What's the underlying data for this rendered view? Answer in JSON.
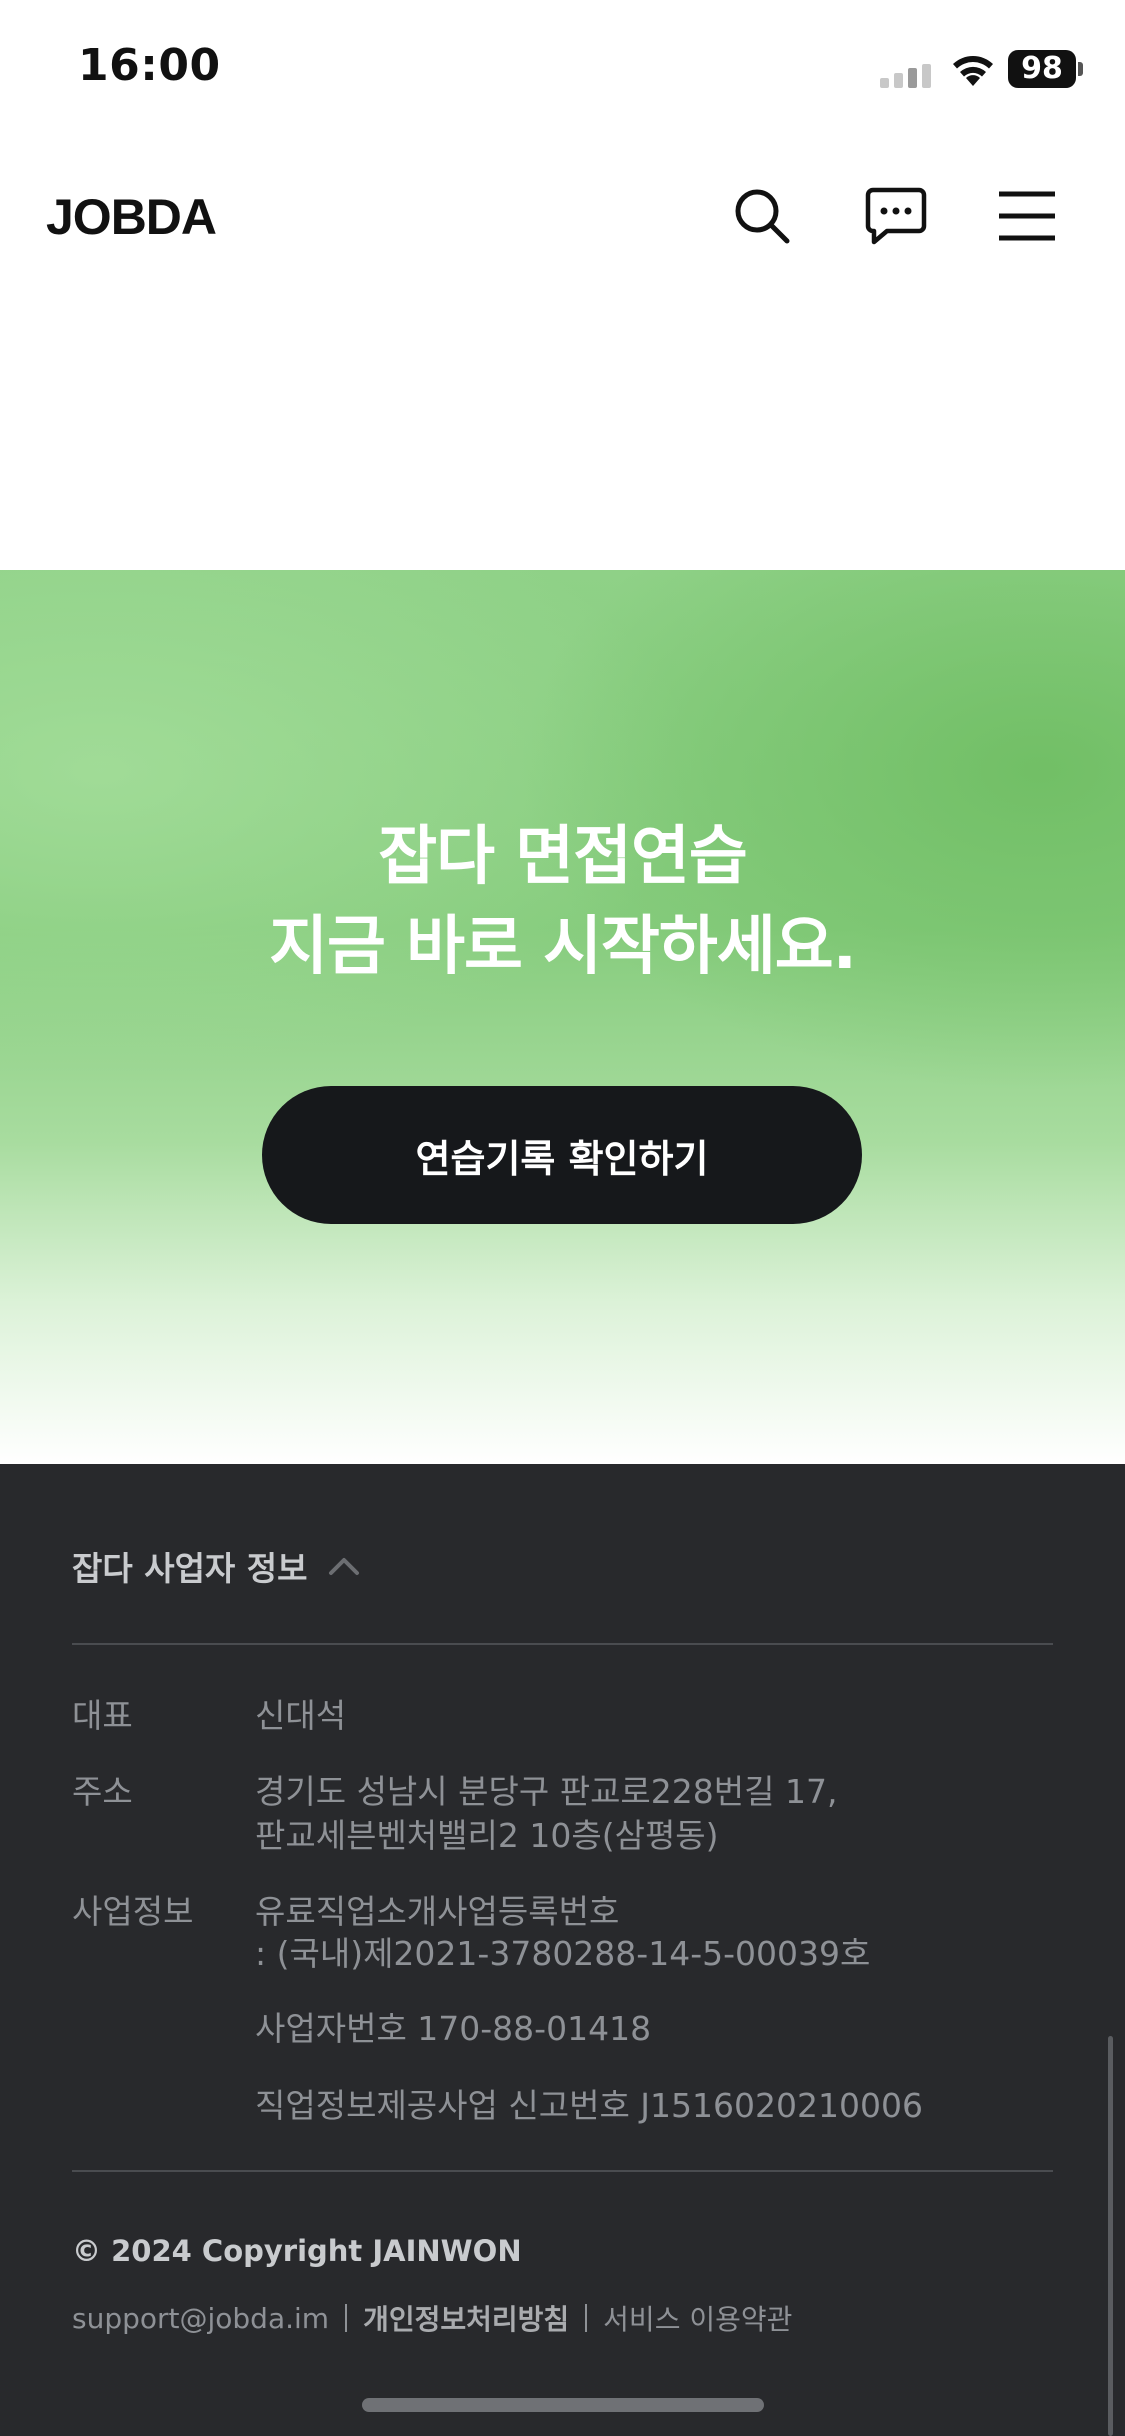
{
  "status_bar": {
    "time": "16:00",
    "battery": "98"
  },
  "header": {
    "logo": "JOBDA",
    "icons": [
      "search-icon",
      "chat-icon",
      "menu-icon"
    ]
  },
  "hero": {
    "title_line1": "잡다 면접연습",
    "title_line2": "지금 바로 시작하세요.",
    "button_label": "연습기록 확인하기",
    "colors": {
      "gradient_top": "#8fd187",
      "button_bg": "#16181b"
    }
  },
  "footer": {
    "toggle_label": "잡다 사업자 정보",
    "representative_label": "대표",
    "representative_value": "신대석",
    "address_label": "주소",
    "address_line1": "경기도 성남시 분당구 판교로228번길 17,",
    "address_line2": "판교세븐벤처밸리2 10층(삼평동)",
    "business_label": "사업정보",
    "business_line1": "유료직업소개사업등록번호",
    "business_line2": ": (국내)제2021-3780288-14-5-00039호",
    "business_number": "사업자번호  170-88-01418",
    "report_number": "직업정보제공사업 신고번호 J1516020210006",
    "copyright": "© 2024 Copyright JAINWON",
    "links": {
      "email": "support@jobda.im",
      "privacy": "개인정보처리방침",
      "terms": "서비스 이용약관"
    },
    "colors": {
      "background": "#28292c"
    }
  }
}
